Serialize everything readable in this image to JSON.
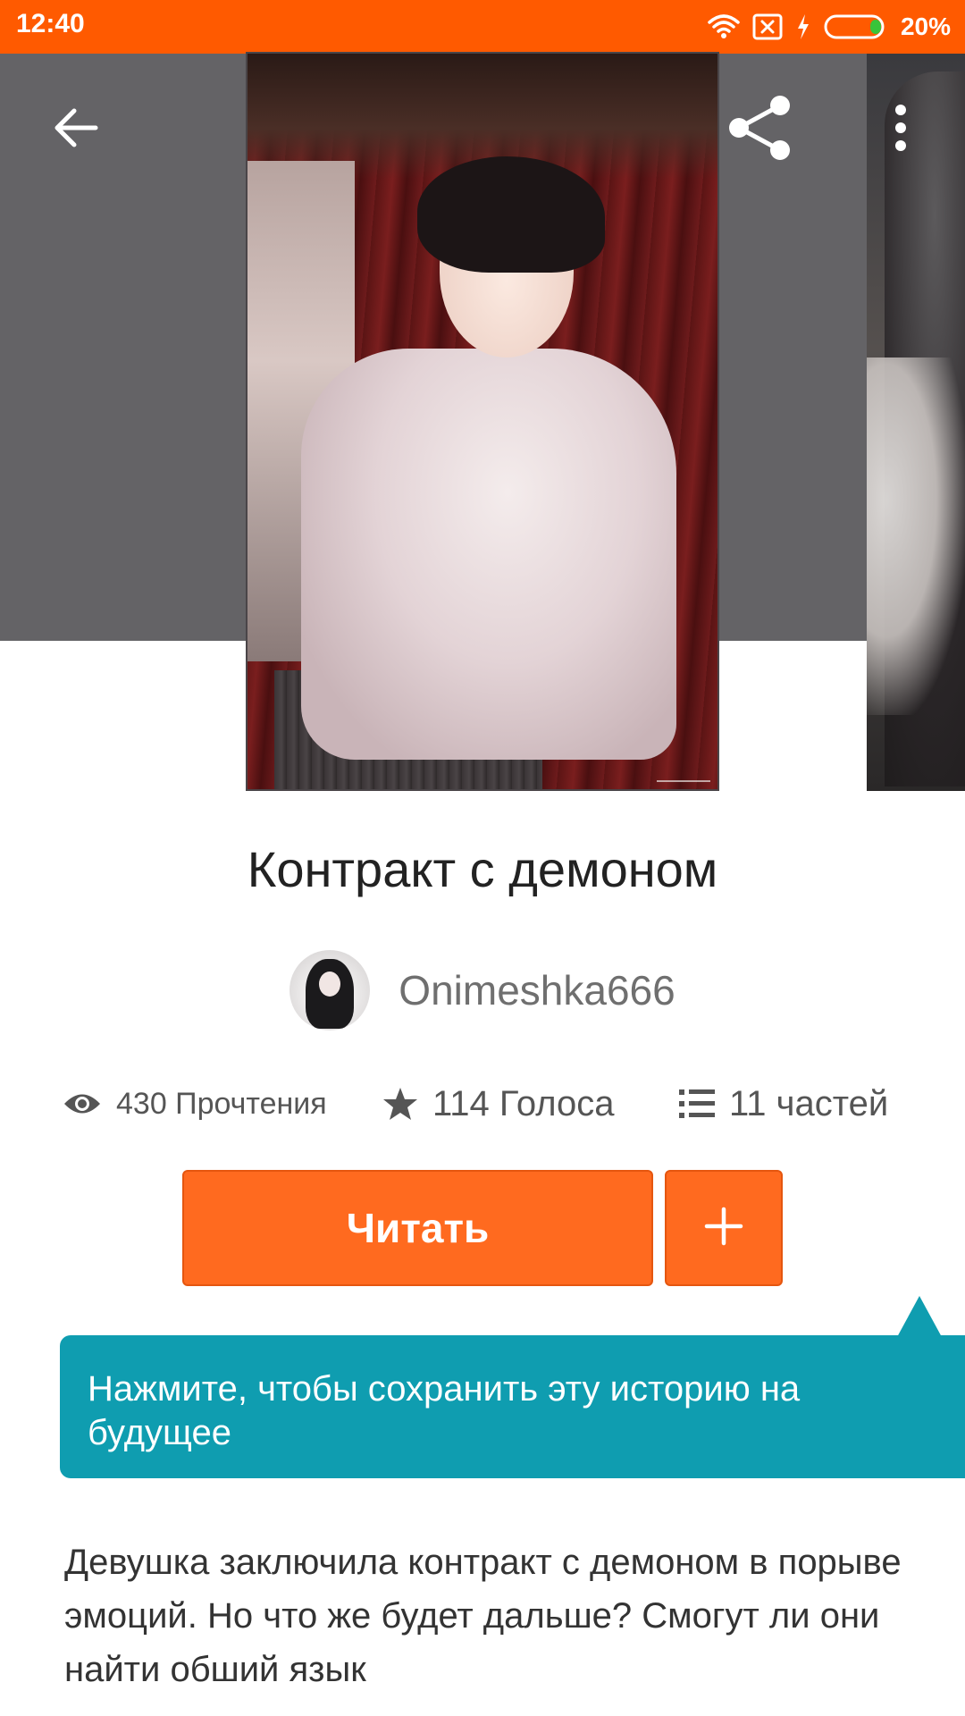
{
  "status_bar": {
    "time": "12:40",
    "battery_percent": "20%",
    "battery_level": 0.2,
    "icons": [
      "wifi-icon",
      "sim-off-icon",
      "charging-icon",
      "battery-icon"
    ]
  },
  "toolbar": {
    "back_icon": "arrow-left-icon",
    "share_icon": "share-icon",
    "more_icon": "more-vertical-icon"
  },
  "story": {
    "title": "Контракт с демоном",
    "author": "Onimeshka666",
    "stats": {
      "reads": "430 Прочтения",
      "votes": "114 Голоса",
      "parts": "11 частей"
    },
    "read_button_label": "Читать",
    "add_button_label": "+",
    "tooltip": "Нажмите, чтобы сохранить эту историю на будущее",
    "description": "Девушка заключила контракт с демоном в порыве эмоций. Но что же будет дальше? Смогут ли они найти обший язык"
  },
  "colors": {
    "status_bar": "#ff5a00",
    "accent_orange": "#ff6a1f",
    "tooltip_teal": "#0f9db0",
    "header_gray": "#646366"
  }
}
